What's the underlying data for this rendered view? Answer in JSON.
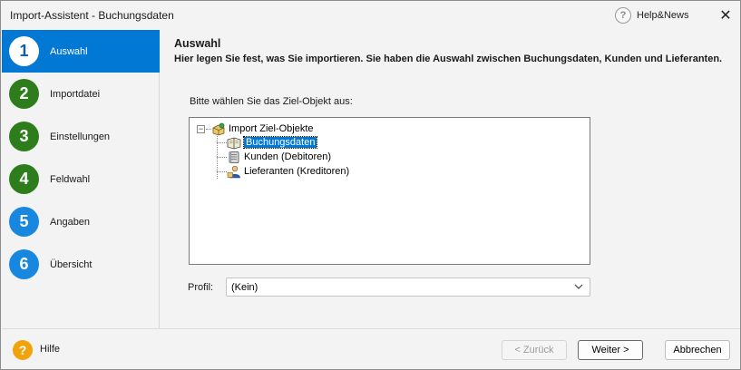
{
  "window": {
    "title": "Import-Assistent - Buchungsdaten",
    "help_news_label": "Help&News",
    "help_news_icon": "question-circle-icon",
    "close_icon": "close-icon",
    "close_glyph": "✕"
  },
  "steps": [
    {
      "number": "1",
      "label": "Auswahl",
      "color": "#0078d4",
      "active": true
    },
    {
      "number": "2",
      "label": "Importdatei",
      "color": "#2d7d1d",
      "active": false
    },
    {
      "number": "3",
      "label": "Einstellungen",
      "color": "#2d7d1d",
      "active": false
    },
    {
      "number": "4",
      "label": "Feldwahl",
      "color": "#2d7d1d",
      "active": false
    },
    {
      "number": "5",
      "label": "Angaben",
      "color": "#1787e0",
      "active": false
    },
    {
      "number": "6",
      "label": "Übersicht",
      "color": "#1787e0",
      "active": false
    }
  ],
  "main": {
    "title": "Auswahl",
    "description": "Hier legen Sie fest, was Sie importieren. Sie haben die Auswahl zwischen Buchungsdaten, Kunden und Lieferanten.",
    "prompt": "Bitte wählen Sie das Ziel-Objekt aus:",
    "tree": {
      "expander_glyph": "−",
      "root": {
        "label": "Import Ziel-Objekte",
        "icon": "import-box-icon"
      },
      "children": [
        {
          "label": "Buchungsdaten",
          "icon": "journal-book-icon",
          "selected": true
        },
        {
          "label": "Kunden (Debitoren)",
          "icon": "customer-card-icon",
          "selected": false
        },
        {
          "label": "Lieferanten (Kreditoren)",
          "icon": "supplier-person-icon",
          "selected": false
        }
      ]
    },
    "profile": {
      "label": "Profil:",
      "value": "(Kein)"
    }
  },
  "footer": {
    "help_label": "Hilfe",
    "help_glyph": "?",
    "back_label": "< Zurück",
    "next_label": "Weiter >",
    "cancel_label": "Abbrechen"
  },
  "colors": {
    "accent": "#0078d4",
    "step_green": "#2d7d1d",
    "step_blue": "#1787e0",
    "help_orange": "#f0a30a"
  }
}
